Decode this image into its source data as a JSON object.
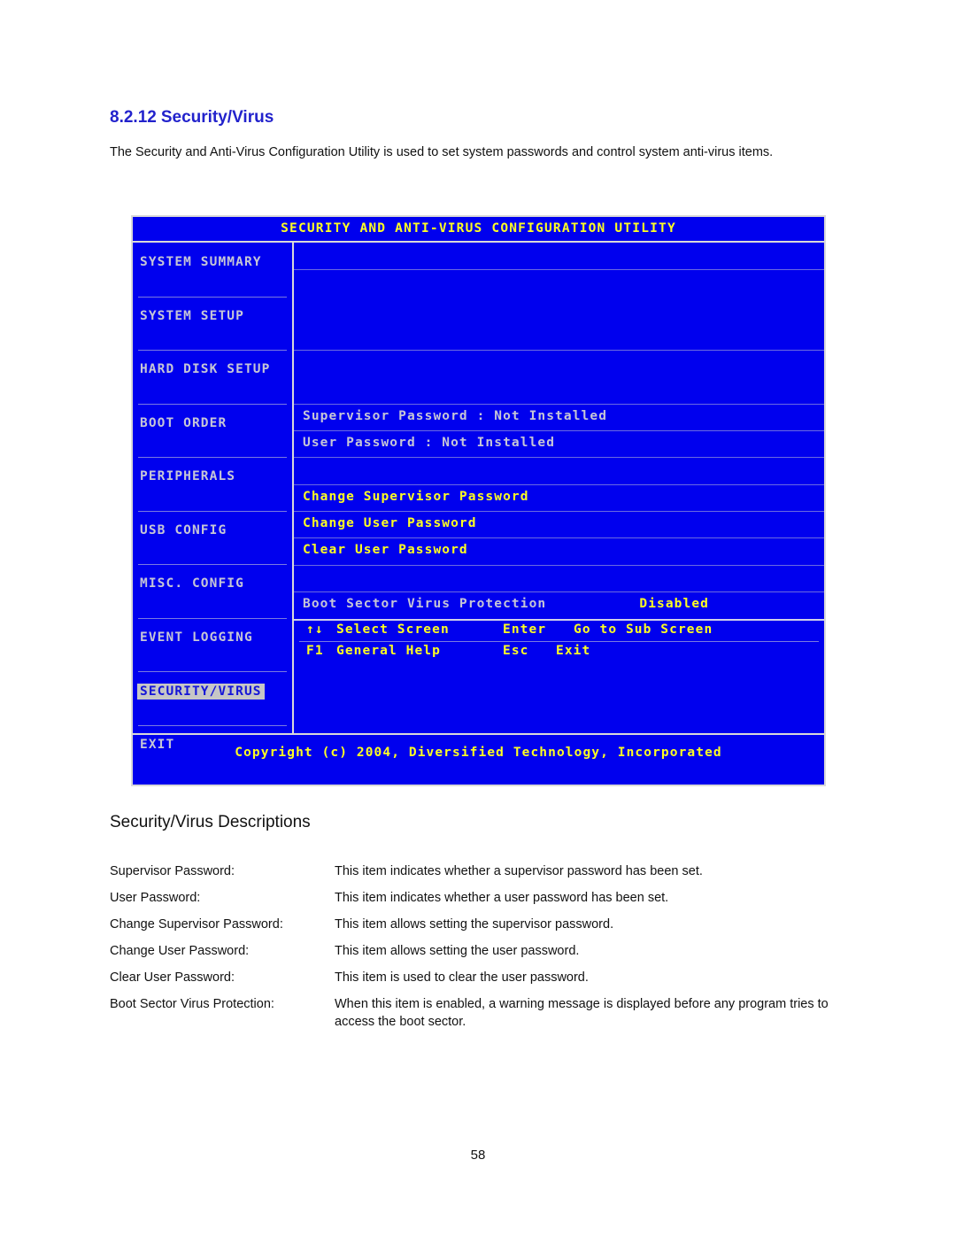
{
  "document": {
    "section_number": "8.2.12",
    "section_title": "Security/Virus",
    "intro_paragraph": "The Security and Anti-Virus Configuration Utility is used to set system passwords and control system anti-virus items.",
    "subheading": "Security/Virus Descriptions",
    "page_number": "58"
  },
  "bios": {
    "title": "SECURITY AND ANTI-VIRUS CONFIGURATION UTILITY",
    "colors": {
      "screen_background": "#0000ee",
      "border": "#d9d9d9",
      "title_text": "#ffff22",
      "normal_text": "#c6c6d6",
      "highlight_background": "#c6c6c6",
      "highlight_text": "#1414d8"
    },
    "menu": [
      {
        "label": "SYSTEM SUMMARY",
        "selected": false
      },
      {
        "label": "SYSTEM SETUP",
        "selected": false
      },
      {
        "label": "HARD DISK SETUP",
        "selected": false
      },
      {
        "label": "BOOT ORDER",
        "selected": false
      },
      {
        "label": "PERIPHERALS",
        "selected": false
      },
      {
        "label": "USB CONFIG",
        "selected": false
      },
      {
        "label": "MISC. CONFIG",
        "selected": false
      },
      {
        "label": "EVENT LOGGING",
        "selected": false
      },
      {
        "label": "SECURITY/VIRUS",
        "selected": true
      },
      {
        "label": "EXIT",
        "selected": false
      }
    ],
    "status_rows": [
      {
        "label": "Supervisor Password : Not Installed"
      },
      {
        "label": "User Password       : Not Installed"
      }
    ],
    "action_rows": [
      {
        "label": "Change Supervisor Password"
      },
      {
        "label": "Change User Password"
      },
      {
        "label": "Clear User Password"
      }
    ],
    "setting_row": {
      "label": "Boot Sector Virus Protection",
      "value": "Disabled"
    },
    "help_bar": {
      "line1_keys": "↑↓",
      "line1_desc": "Select Screen",
      "line1_keys2": "Enter",
      "line1_desc2": "Go to Sub Screen",
      "line2_keys": "F1",
      "line2_desc": "General Help",
      "line2_keys2": "Esc",
      "line2_desc2": "Exit"
    },
    "copyright": "Copyright (c) 2004, Diversified Technology, Incorporated"
  },
  "descriptions": [
    {
      "label": "Supervisor Password:",
      "text": "This item indicates whether a supervisor password has been set."
    },
    {
      "label": "User Password:",
      "text": "This item indicates whether a user password has been set."
    },
    {
      "label": "Change Supervisor Password:",
      "text": "This item allows setting the supervisor password."
    },
    {
      "label": "Change User Password:",
      "text": "This item allows setting the user password."
    },
    {
      "label": "Clear User Password:",
      "text": "This item is used to clear the user password."
    },
    {
      "label": "Boot Sector Virus Protection:",
      "text": "When this item is enabled, a warning message is displayed before any program tries to access the boot sector."
    }
  ]
}
